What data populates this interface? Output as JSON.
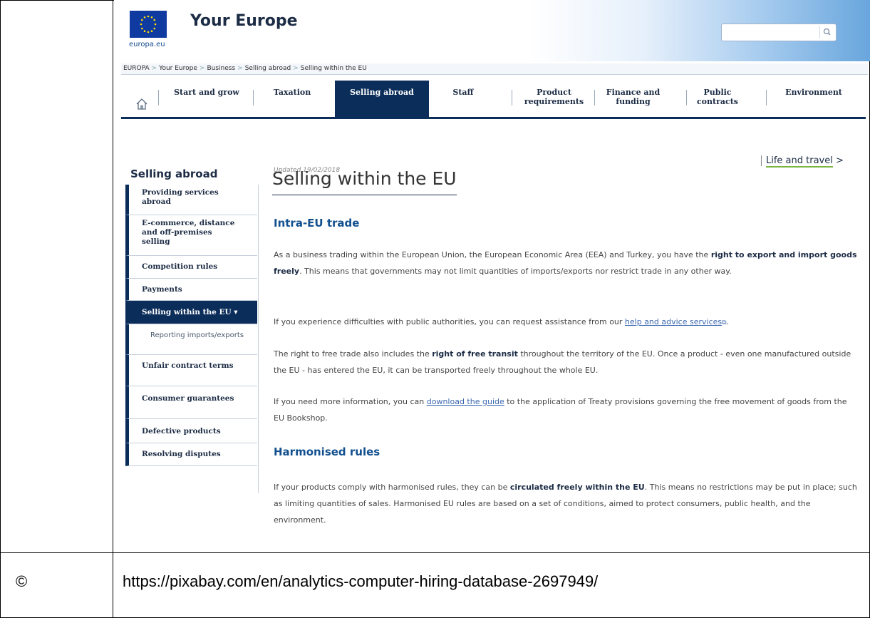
{
  "header": {
    "site_title": "Your Europe",
    "logo_caption": "europa.eu",
    "search_placeholder": ""
  },
  "breadcrumb": [
    "EUROPA",
    "Your Europe",
    "Business",
    "Selling abroad",
    "Selling within the EU"
  ],
  "nav": {
    "items": [
      {
        "label": "Start and grow"
      },
      {
        "label": "Taxation"
      },
      {
        "label": "Selling abroad",
        "active": true
      },
      {
        "label": "Staff"
      },
      {
        "label": "Product requirements"
      },
      {
        "label": "Finance and funding"
      },
      {
        "label": "Public contracts"
      },
      {
        "label": "Environment"
      }
    ]
  },
  "sidebar": {
    "title": "Selling abroad",
    "items": [
      {
        "label": "Providing services abroad"
      },
      {
        "label": "E-commerce, distance and off-premises selling"
      },
      {
        "label": "Competition rules"
      },
      {
        "label": "Payments"
      },
      {
        "label": "Selling within the EU ▾",
        "active": true
      },
      {
        "label": "Reporting imports/exports",
        "sub": true
      },
      {
        "label": "Unfair contract terms"
      },
      {
        "label": "Consumer guarantees"
      },
      {
        "label": "Defective products"
      },
      {
        "label": "Resolving disputes"
      }
    ]
  },
  "main": {
    "updated": "Updated 19/02/2018",
    "life_and_travel": "Life and travel",
    "life_and_travel_arrow": ">",
    "title": "Selling within the EU",
    "section1_heading": "Intra-EU trade",
    "p1_a": "As a business trading within the European Union, the European Economic Area (EEA) and Turkey, you have the ",
    "p1_b": "right to export and import goods freely",
    "p1_c": ". This means that governments may not limit quantities of imports/exports nor restrict trade in any other way.",
    "p2_a": "If you experience difficulties with public authorities, you can request assistance from our ",
    "p2_link": "help and advice services",
    "p2_c": ".",
    "p3_a": "The right to free trade also includes the ",
    "p3_b": "right of free transit",
    "p3_c": " throughout the territory of the EU. Once a product - even one manufactured outside the EU - has entered the EU, it can be transported freely throughout the whole EU.",
    "p4_a": "If you need more information, you can ",
    "p4_link": "download the guide",
    "p4_c": " to the application of Treaty provisions governing the free movement of goods from the EU Bookshop.",
    "section2_heading": "Harmonised rules",
    "p5_a": "If your products comply with harmonised rules, they can be ",
    "p5_b": "circulated freely within the EU",
    "p5_c": ". This means no restrictions may be put in place; such as limiting quantities of sales. Harmonised EU rules are based on a set of conditions, aimed to protect consumers, public health, and the environment."
  },
  "footer": {
    "copyright": "©",
    "source_url": "https://pixabay.com/en/analytics-computer-hiring-database-2697949/"
  },
  "colors": {
    "navy": "#0b2d5a",
    "heading_blue": "#12508f",
    "link_blue": "#3a67b0"
  }
}
